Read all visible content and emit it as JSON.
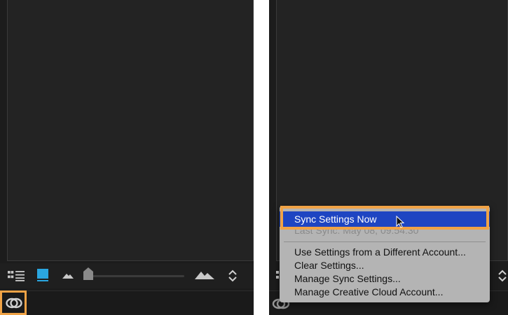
{
  "left_panel": {
    "toolbar": {
      "list_view_icon": "list-view-icon",
      "grid_view_icon": "grid-view-icon",
      "thumbnail_small_icon": "small-thumbnail-icon",
      "thumbnail_large_icon": "large-thumbnail-icon",
      "sort_icon": "sort-chevrons-icon"
    },
    "status": {
      "sync_icon": "creative-cloud-icon"
    }
  },
  "sync_menu": {
    "items": [
      {
        "label": "Sync Settings Now",
        "state": "selected"
      },
      {
        "label": "Last Sync: May 08, 09:54:30",
        "state": "disabled"
      },
      {
        "label": "Use Settings from a Different Account...",
        "state": "normal"
      },
      {
        "label": "Clear Settings...",
        "state": "normal"
      },
      {
        "label": "Manage Sync Settings...",
        "state": "normal"
      },
      {
        "label": "Manage Creative Cloud Account...",
        "state": "normal"
      }
    ]
  },
  "colors": {
    "panel_bg": "#1c1c1c",
    "highlight": "#f0a346",
    "selection": "#1e45c2",
    "accent": "#2aa6e0"
  }
}
